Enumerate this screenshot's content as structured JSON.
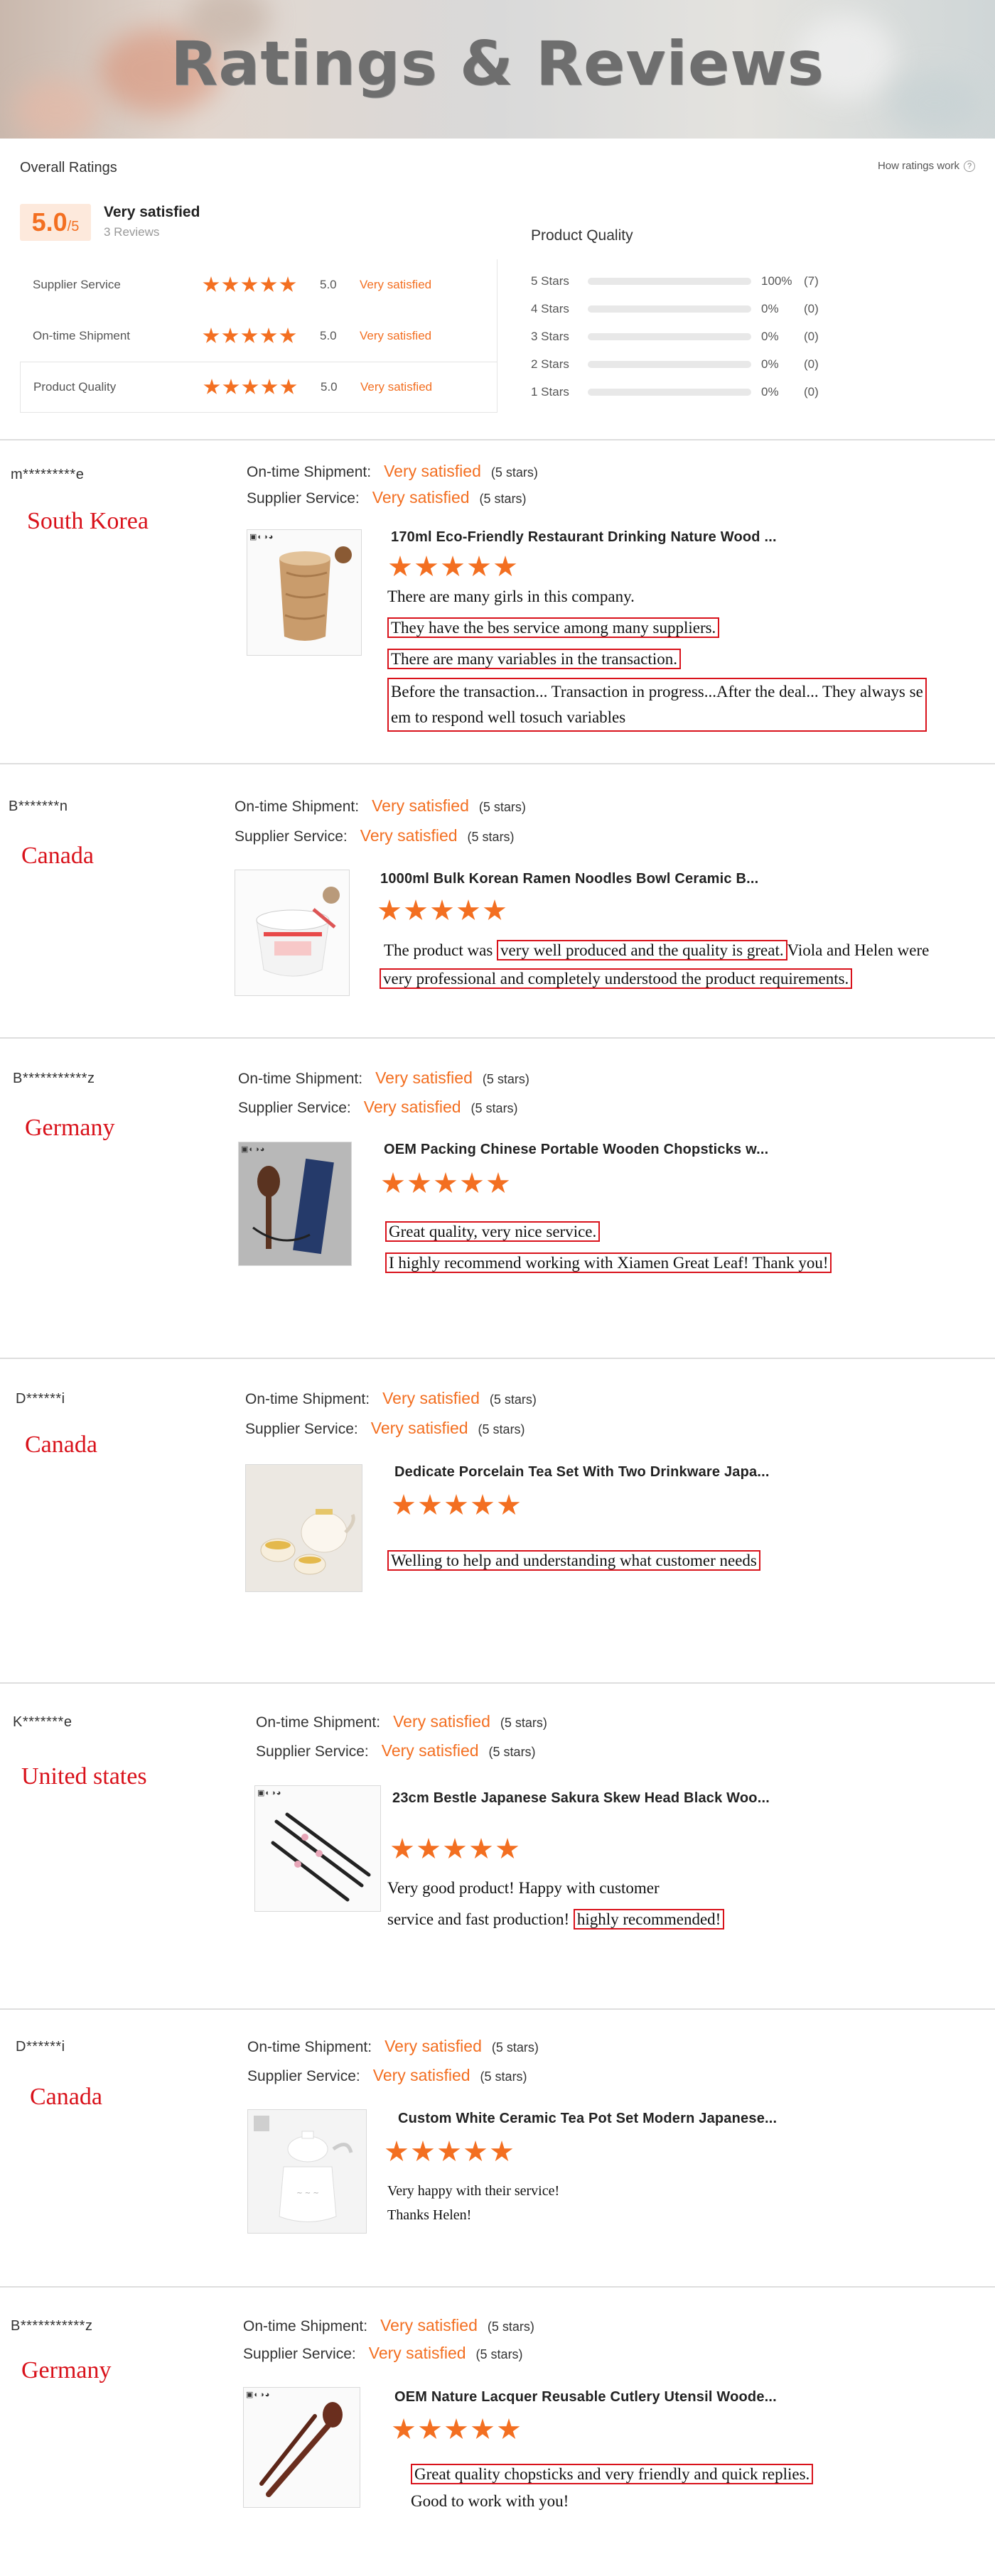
{
  "banner": {
    "title": "Ratings & Reviews"
  },
  "overall": {
    "title": "Overall Ratings",
    "how_link": "How ratings work",
    "score": "5.0",
    "score_max": "/5",
    "score_label": "Very satisfied",
    "review_count": "3 Reviews",
    "criteria": [
      {
        "name": "Supplier Service",
        "value": "5.0",
        "label": "Very satisfied",
        "stars": 5
      },
      {
        "name": "On-time Shipment",
        "value": "5.0",
        "label": "Very satisfied",
        "stars": 5
      },
      {
        "name": "Product Quality",
        "value": "5.0",
        "label": "Very satisfied",
        "stars": 5
      }
    ],
    "product_quality": {
      "title": "Product Quality",
      "rows": [
        {
          "label": "5 Stars",
          "percent": "100%",
          "count": "(7)",
          "fill": 1.0
        },
        {
          "label": "4 Stars",
          "percent": "0%",
          "count": "(0)",
          "fill": 0
        },
        {
          "label": "3 Stars",
          "percent": "0%",
          "count": "(0)",
          "fill": 0
        },
        {
          "label": "2 Stars",
          "percent": "0%",
          "count": "(0)",
          "fill": 0
        },
        {
          "label": "1 Stars",
          "percent": "0%",
          "count": "(0)",
          "fill": 0
        }
      ]
    }
  },
  "labels": {
    "ontime": "On-time Shipment:",
    "supplier": "Supplier Service:",
    "very_satisfied": "Very satisfied",
    "five_stars": "(5 stars)"
  },
  "reviews": [
    {
      "reviewer": "m*********e",
      "country": "South Korea",
      "product": "170ml Eco-Friendly Restaurant Drinking Nature Wood ...",
      "rating": 5,
      "comments": [
        "There are many girls in this company.",
        "They have the bes service among many suppliers.",
        "There are many variables in the transaction.",
        "Before the transaction... Transaction in progress...After the deal... They always se",
        "em to respond well tosuch variables"
      ]
    },
    {
      "reviewer": "B*******n",
      "country": "Canada",
      "product": "1000ml Bulk Korean Ramen Noodles Bowl Ceramic B...",
      "rating": 5,
      "comments": [
        "The product was ",
        "very well produced and the quality is great.",
        "Viola and Helen were",
        "very professional and completely understood the product requirements."
      ]
    },
    {
      "reviewer": "B***********z",
      "country": "Germany",
      "product": "OEM Packing Chinese Portable Wooden Chopsticks w...",
      "rating": 5,
      "comments": [
        "Great quality, very nice service.",
        "I highly recommend working with Xiamen Great Leaf! Thank you!"
      ]
    },
    {
      "reviewer": "D******i",
      "country": "Canada",
      "product": "Dedicate Porcelain Tea Set With Two Drinkware Japa...",
      "rating": 5,
      "comments": [
        "Welling to help and understanding what customer needs"
      ]
    },
    {
      "reviewer": "K*******e",
      "country": "United states",
      "product": "23cm Bestle Japanese Sakura Skew Head Black Woo...",
      "rating": 5,
      "comments": [
        "Very good product! Happy with customer",
        "service and fast production! ",
        "highly recommended!"
      ]
    },
    {
      "reviewer": "D******i",
      "country": "Canada",
      "product": "Custom White Ceramic Tea Pot Set Modern Japanese...",
      "rating": 5,
      "comments": [
        "Very happy with their service!",
        "Thanks Helen!"
      ]
    },
    {
      "reviewer": "B***********z",
      "country": "Germany",
      "product": "OEM Nature Lacquer Reusable Cutlery Utensil Woode...",
      "rating": 5,
      "comments": [
        "Great quality chopsticks and very friendly and quick replies.",
        "Good to work with you!"
      ]
    }
  ],
  "colors": {
    "accent": "#f36f21",
    "highlight": "#d9121b"
  }
}
